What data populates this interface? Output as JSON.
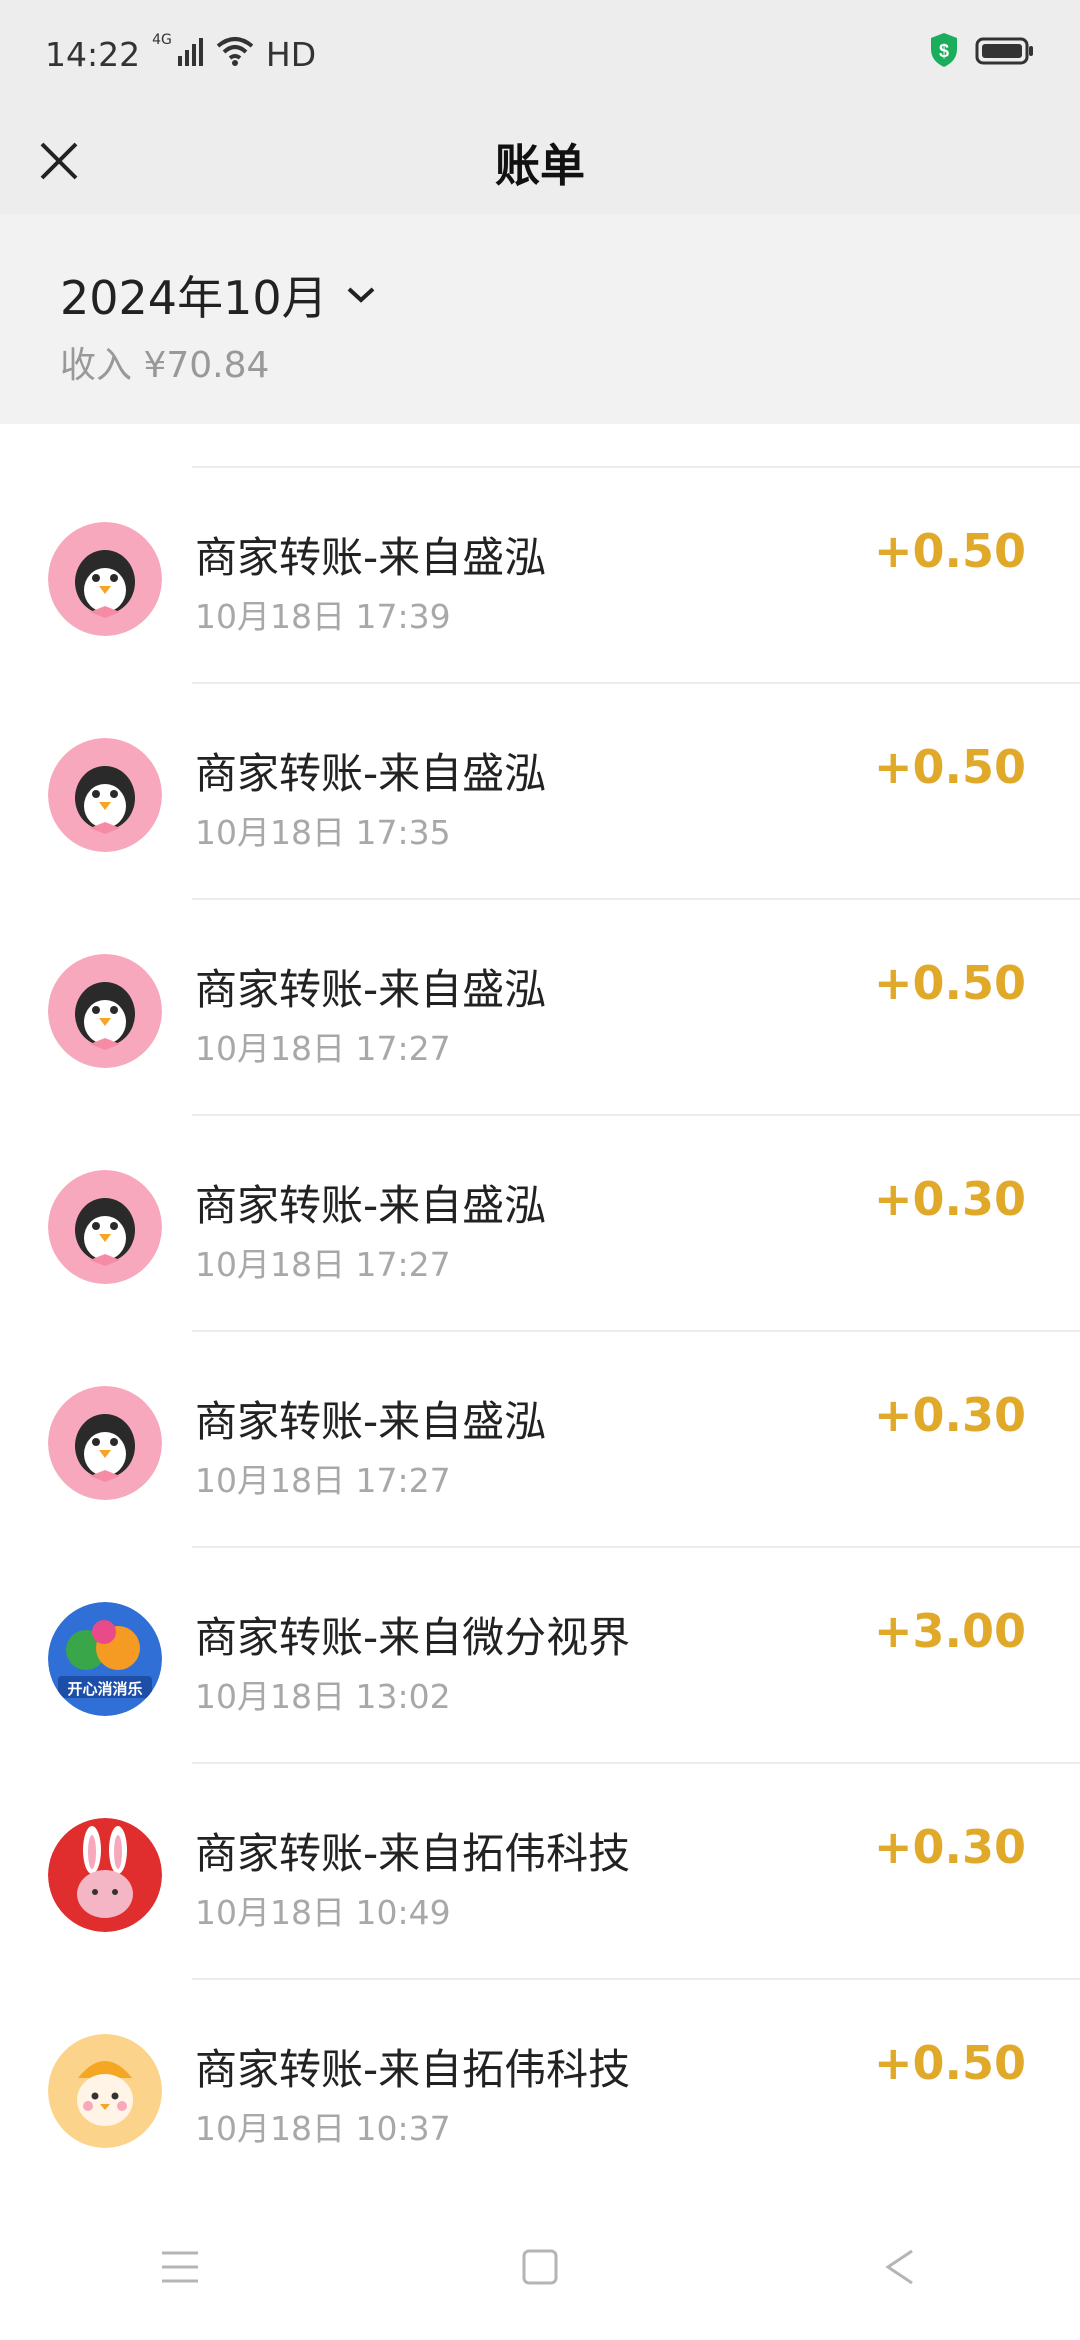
{
  "status_bar": {
    "time": "14:22",
    "signal_label": "4G",
    "hd_label": "HD",
    "icons": [
      "signal-icon",
      "wifi-icon",
      "shield-dollar-icon",
      "battery-icon"
    ]
  },
  "nav": {
    "title": "账单",
    "close_icon": "close-icon"
  },
  "summary": {
    "month": "2024年10月",
    "income": "收入 ¥70.84"
  },
  "transactions": [
    {
      "title": "商家转账-来自盛泓",
      "time": "10月18日 17:39",
      "amount": "+0.50",
      "avatar": "penguin-avatar"
    },
    {
      "title": "商家转账-来自盛泓",
      "time": "10月18日 17:35",
      "amount": "+0.50",
      "avatar": "penguin-avatar"
    },
    {
      "title": "商家转账-来自盛泓",
      "time": "10月18日 17:27",
      "amount": "+0.50",
      "avatar": "penguin-avatar"
    },
    {
      "title": "商家转账-来自盛泓",
      "time": "10月18日 17:27",
      "amount": "+0.30",
      "avatar": "penguin-avatar"
    },
    {
      "title": "商家转账-来自盛泓",
      "time": "10月18日 17:27",
      "amount": "+0.30",
      "avatar": "penguin-avatar"
    },
    {
      "title": "商家转账-来自微分视界",
      "time": "10月18日 13:02",
      "amount": "+3.00",
      "avatar": "fruit-game-avatar",
      "avatar_text": "开心消消乐"
    },
    {
      "title": "商家转账-来自拓伟科技",
      "time": "10月18日 10:49",
      "amount": "+0.30",
      "avatar": "rabbit-avatar"
    },
    {
      "title": "商家转账-来自拓伟科技",
      "time": "10月18日 10:37",
      "amount": "+0.50",
      "avatar": "chick-avatar"
    }
  ],
  "colors": {
    "amount": "#e0a92a",
    "header_bg": "#ededed",
    "summary_bg": "#f2f2f2",
    "penguin_bg": "#f7a8bd",
    "shield": "#1aad5b"
  },
  "bottom_nav": {
    "icons": [
      "menu-icon",
      "home-icon",
      "back-icon"
    ]
  }
}
